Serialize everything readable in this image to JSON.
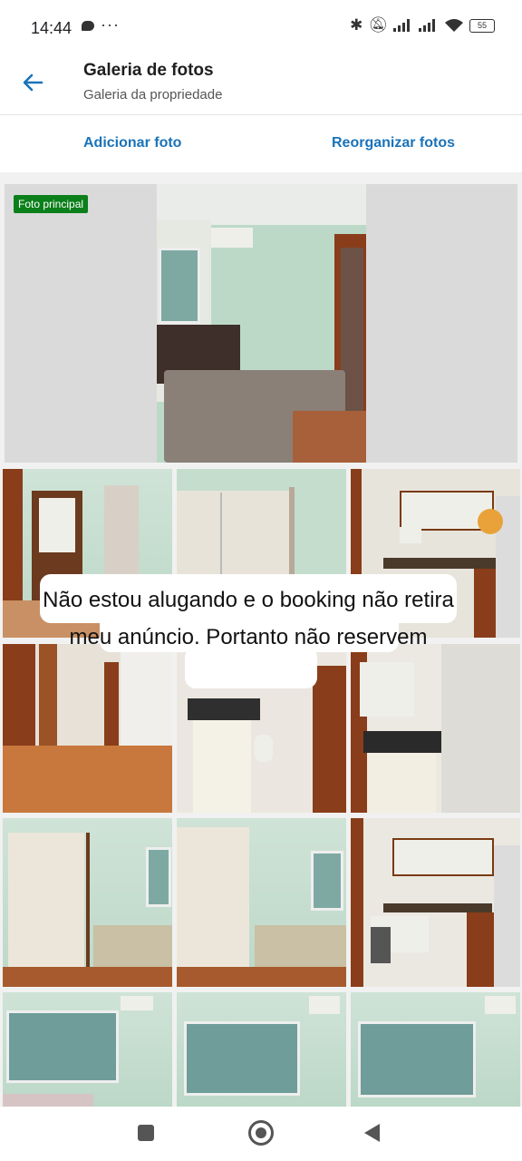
{
  "status_bar": {
    "time": "14:44",
    "dots": "···",
    "battery": "55"
  },
  "header": {
    "title": "Galeria de fotos",
    "subtitle": "Galeria da propriedade"
  },
  "actions": {
    "add": "Adicionar foto",
    "reorder": "Reorganizar fotos"
  },
  "gallery": {
    "main_badge": "Foto principal"
  },
  "overlay": {
    "message": "Não estou alugando e o booking não retira meu anúncio. Portanto não reservem"
  },
  "colors": {
    "accent": "#1a73b8",
    "badge": "#0a7f1a"
  },
  "icons": {
    "back": "back-arrow-icon",
    "nav_recents": "square-icon",
    "nav_home": "circle-icon",
    "nav_back": "triangle-back-icon"
  }
}
